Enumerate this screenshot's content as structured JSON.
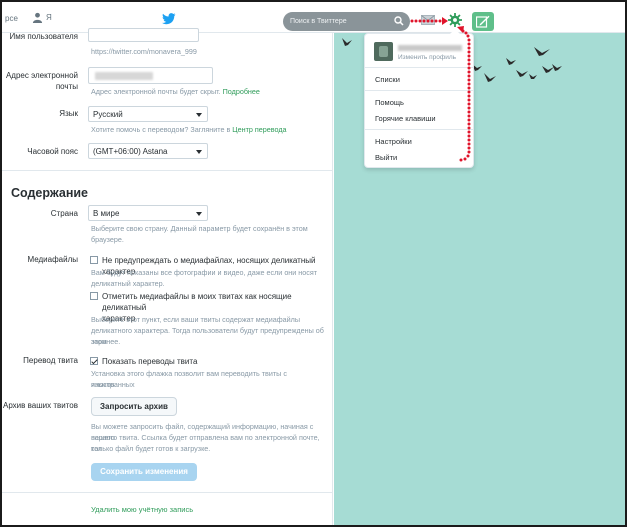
{
  "topbar": {
    "nav_fragment": "рсе",
    "me_label": "Я",
    "search_placeholder": "Поиск в Твиттере"
  },
  "account": {
    "username_label": "Имя пользователя",
    "username_url": "https://twitter.com/monavera_999",
    "email_label_line1": "Адрес электронной",
    "email_label_line2": "почты",
    "email_hint": "Адрес электронной почты будет скрыт.",
    "email_hint_link": "Подробнее",
    "language_label": "Язык",
    "language_value": "Русский",
    "language_hint": "Хотите помочь с переводом? Загляните в",
    "language_hint_link": "Центр перевода",
    "timezone_label": "Часовой пояс",
    "timezone_value": "(GMT+06:00) Astana"
  },
  "content": {
    "section_title": "Содержание",
    "country_label": "Страна",
    "country_value": "В мире",
    "country_hint_line1": "Выберите свою страну. Данный параметр будет сохранён в этом",
    "country_hint_line2": "браузере.",
    "media_label": "Медиафайлы",
    "media_opt1": "Не предупреждать о медиафайлах, носящих деликатный характер",
    "media_opt1_hint_line1": "Вам будут показаны все фотографии и видео, даже если они носят",
    "media_opt1_hint_line2": "деликатный характер.",
    "media_opt2_line1": "Отметить медиафайлы в моих твитах как носящие деликатный",
    "media_opt2_line2": "характер",
    "media_opt2_hint_line1": "Выберите этот пункт, если ваши твиты содержат медиафайлы",
    "media_opt2_hint_line2": "деликатного характера. Тогда пользователи будут предупреждены об этом",
    "media_opt2_hint_line3": "заранее.",
    "translate_label": "Перевод твита",
    "translate_opt": "Показать переводы твита",
    "translate_hint_line1": "Установка этого флажка позволит вам переводить твиты с иностранных",
    "translate_hint_line2": "языков.",
    "archive_label": "Архив ваших твитов",
    "archive_button": "Запросить архив",
    "archive_hint_line1": "Вы можете запросить файл, содержащий информацию, начиная с вашего",
    "archive_hint_line2": "первого твита. Ссылка будет отправлена вам по электронной почте, как",
    "archive_hint_line3": "только файл будет готов к загрузке.",
    "save_button": "Сохранить изменения",
    "delete_link": "Удалить мою учётную запись"
  },
  "dropdown": {
    "edit_profile": "Изменить профиль",
    "lists": "Списки",
    "help": "Помощь",
    "shortcuts": "Горячие клавиши",
    "settings": "Настройки",
    "logout": "Выйти"
  },
  "colors": {
    "teal_background": "#a6dcd4",
    "link_green": "#2f9c5a",
    "tweet_button": "#5fbf8a",
    "annotation_red": "#e0142b"
  }
}
